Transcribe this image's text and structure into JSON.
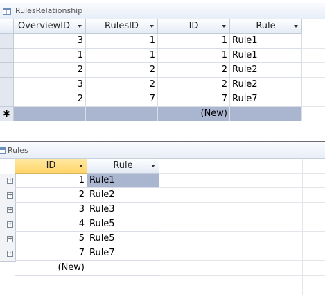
{
  "rel_window": {
    "title": "RulesRelationship",
    "columns": [
      "OverviewID",
      "RulesID",
      "ID",
      "Rule"
    ],
    "rows": [
      [
        "3",
        "1",
        "1",
        "Rule1"
      ],
      [
        "1",
        "1",
        "1",
        "Rule1"
      ],
      [
        "2",
        "2",
        "2",
        "Rule2"
      ],
      [
        "3",
        "2",
        "2",
        "Rule2"
      ],
      [
        "2",
        "7",
        "7",
        "Rule7"
      ]
    ],
    "new_row_label": "(New)",
    "new_row_marker": "✱"
  },
  "rules_window": {
    "title": "Rules",
    "columns": [
      "ID",
      "Rule"
    ],
    "rows": [
      [
        "1",
        "Rule1"
      ],
      [
        "2",
        "Rule2"
      ],
      [
        "3",
        "Rule3"
      ],
      [
        "4",
        "Rule5"
      ],
      [
        "5",
        "Rule5"
      ],
      [
        "7",
        "Rule7"
      ]
    ],
    "new_row_label": "(New)",
    "expand_glyph": "+"
  },
  "colors": {
    "header_selected": "#ffd56a",
    "new_row_bg": "#aab5cf",
    "selected_cell_bg": "#aab5cf"
  }
}
